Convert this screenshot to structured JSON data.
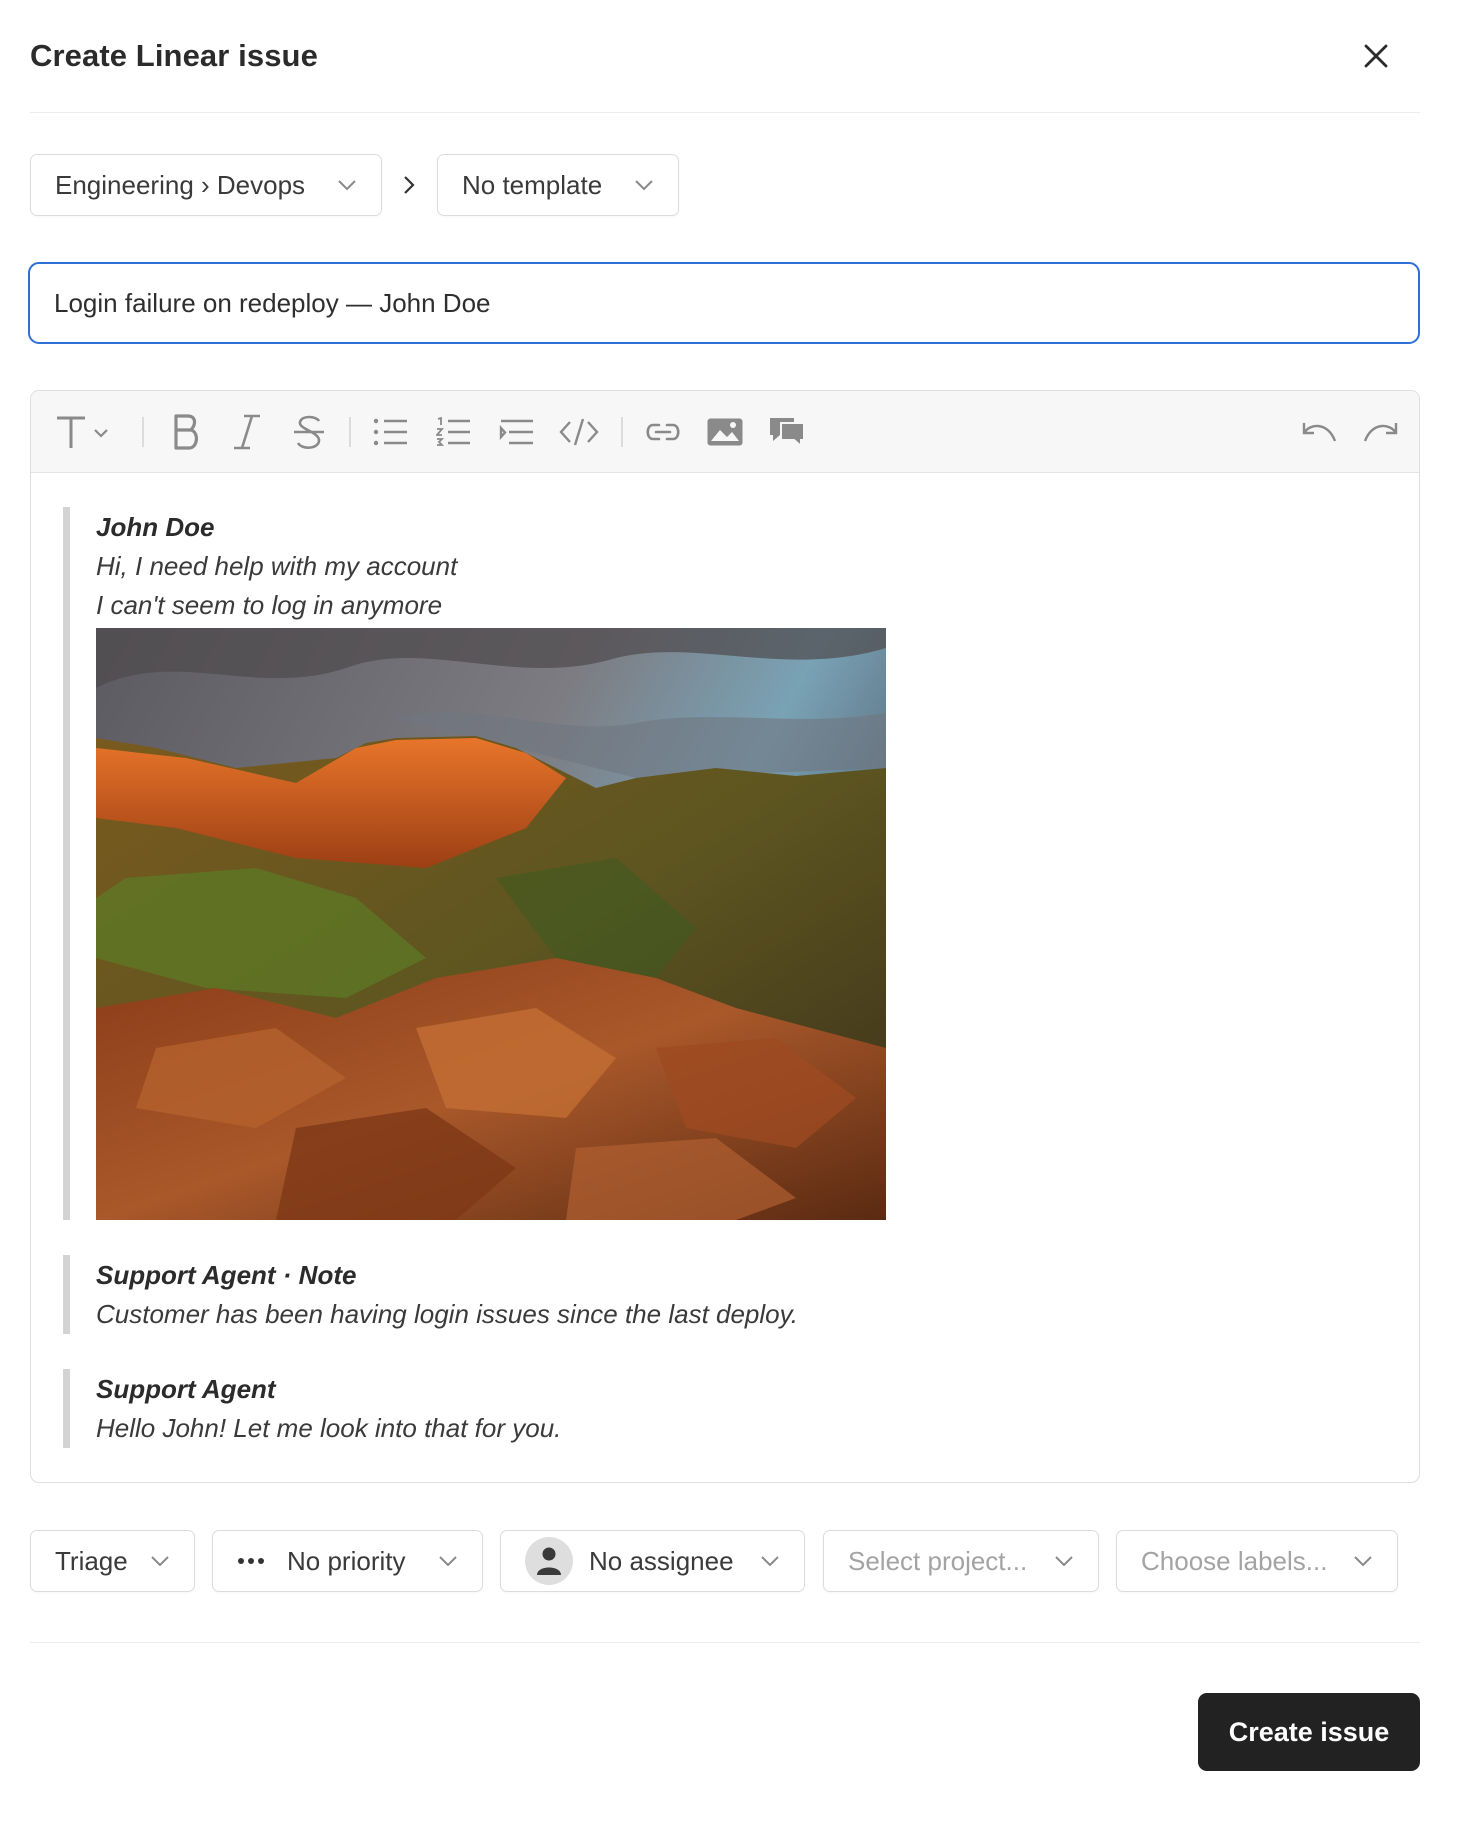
{
  "header": {
    "title": "Create Linear issue",
    "close_icon": "close-icon"
  },
  "team_select": {
    "value": "Engineering › Devops"
  },
  "template_select": {
    "value": "No template"
  },
  "issue_title": {
    "value": "Login failure on redeploy — John Doe"
  },
  "toolbar": {
    "items": [
      "text-style-icon",
      "bold-icon",
      "italic-icon",
      "strikethrough-icon",
      "bullet-list-icon",
      "numbered-list-icon",
      "indent-list-icon",
      "code-icon",
      "link-icon",
      "image-icon",
      "comment-icon",
      "undo-icon",
      "redo-icon"
    ]
  },
  "thread": [
    {
      "author": "John Doe",
      "lines": [
        "Hi, I need help with my account",
        "I can't seem to log in anymore"
      ],
      "attachment": "landscape-photo"
    },
    {
      "author": "Support Agent · Note",
      "lines": [
        "Customer has been having login issues since the last deploy."
      ]
    },
    {
      "author": "Support Agent",
      "lines": [
        "Hello John! Let me look into that for you."
      ]
    }
  ],
  "fields": {
    "status": "Triage",
    "priority": "No priority",
    "assignee": "No assignee",
    "project_placeholder": "Select project...",
    "labels_placeholder": "Choose labels..."
  },
  "footer": {
    "create_label": "Create issue"
  },
  "colors": {
    "focus": "#2f6fd6",
    "primary_button": "#222222"
  }
}
